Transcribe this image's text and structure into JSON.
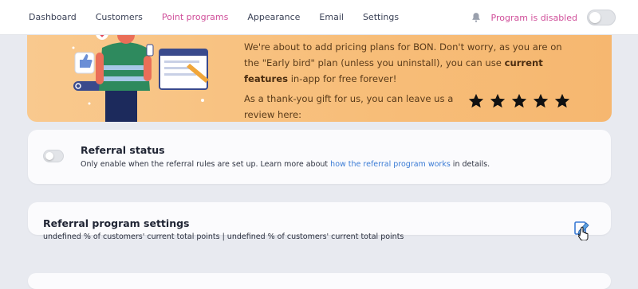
{
  "nav": {
    "items": [
      {
        "label": "Dashboard"
      },
      {
        "label": "Customers"
      },
      {
        "label": "Point programs"
      },
      {
        "label": "Appearance"
      },
      {
        "label": "Email"
      },
      {
        "label": "Settings"
      }
    ],
    "active_index": 2,
    "program_status": "Program is disabled",
    "program_enabled": false
  },
  "banner": {
    "line1_pre": "We're about to add pricing plans for BON. Don't worry, as you are on the \"Early bird\" plan (unless you uninstall), you can use ",
    "line1_bold": "current features",
    "line1_post": " in-app for free forever!",
    "line2": "As a thank-you gift for us, you can leave us a review here:",
    "stars": 5
  },
  "referral_status": {
    "title": "Referral status",
    "desc_pre": "Only enable when the referral rules are set up. Learn more about ",
    "desc_link": "how the referral program works",
    "desc_post": " in details.",
    "enabled": false
  },
  "referral_settings": {
    "title": "Referral program settings",
    "desc": "undefined % of customers' current total points | undefined % of customers' current total points"
  },
  "colors": {
    "accent": "#d04f9a",
    "link": "#3a7bd5",
    "banner": "#f7bd78"
  },
  "icons": {
    "bell": "bell-icon",
    "star": "star-icon",
    "edit": "edit-icon",
    "cursor": "pointer-cursor-icon"
  }
}
